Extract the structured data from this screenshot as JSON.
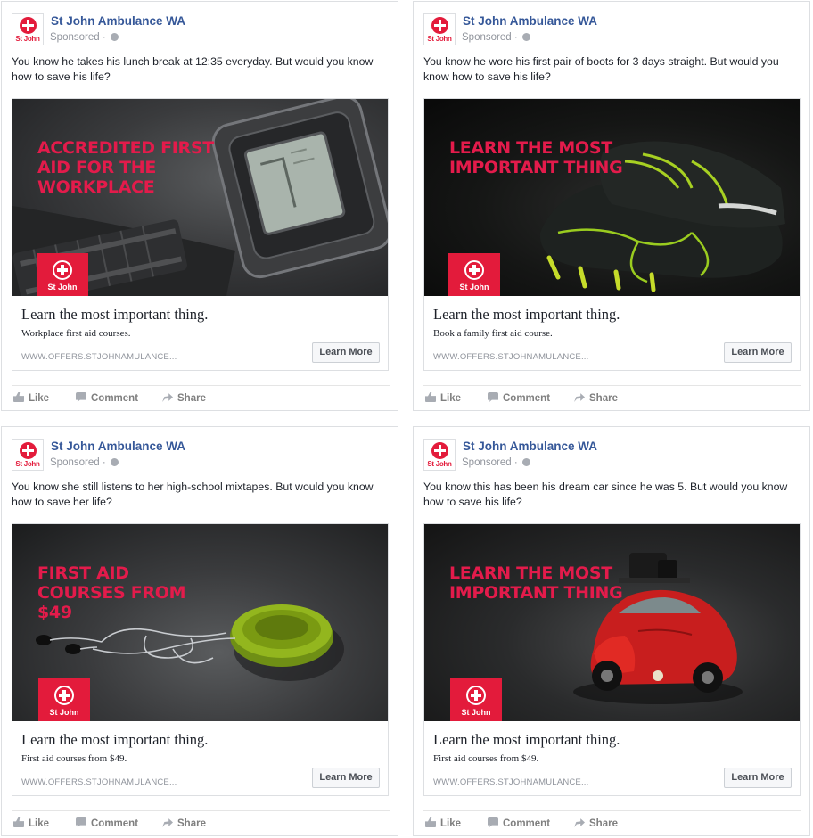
{
  "page": {
    "name": "St John Ambulance WA",
    "sponsored": "Sponsored ·",
    "logo_text": "St John",
    "badge_text": "St John"
  },
  "colors": {
    "brand_red": "#e31b3b",
    "headline_red": "#e31b4b",
    "link_blue": "#365899",
    "muted_gray": "#90949c"
  },
  "icons": [
    "st-john-logo-icon",
    "globe-icon",
    "like-icon",
    "comment-icon",
    "share-icon"
  ],
  "actions": {
    "like": "Like",
    "comment": "Comment",
    "share": "Share"
  },
  "posts": [
    {
      "text": "You know he takes his lunch break at 12:35 everyday. But would you know how to save his life?",
      "headline": "ACCREDITED FIRST AID FOR THE WORKPLACE",
      "image_subject": "wristwatch",
      "cta_title": "Learn the most important thing.",
      "cta_description": "Workplace first aid courses.",
      "url": "WWW.OFFERS.STJOHNAMULANCE...",
      "button": "Learn More"
    },
    {
      "text": "You know he wore his first pair of boots for 3 days straight. But would you know how to save his life?",
      "headline": "LEARN THE MOST IMPORTANT THING",
      "image_subject": "football-boots",
      "cta_title": "Learn the most important thing.",
      "cta_description": "Book a family first aid course.",
      "url": "WWW.OFFERS.STJOHNAMULANCE...",
      "button": "Learn More"
    },
    {
      "text": "You know she still listens to her high-school mixtapes. But would you know how to save her life?",
      "headline": "FIRST AID COURSES FROM $49",
      "image_subject": "cd-player",
      "cta_title": "Learn the most important thing.",
      "cta_description": "First aid courses from $49.",
      "url": "WWW.OFFERS.STJOHNAMULANCE...",
      "button": "Learn More"
    },
    {
      "text": "You know this has been his dream car since he was 5. But would you know how to save his life?",
      "headline": "LEARN THE MOST IMPORTANT THING",
      "image_subject": "toy-car",
      "cta_title": "Learn the most important thing.",
      "cta_description": "First aid courses from $49.",
      "url": "WWW.OFFERS.STJOHNAMULANCE...",
      "button": "Learn More"
    }
  ]
}
